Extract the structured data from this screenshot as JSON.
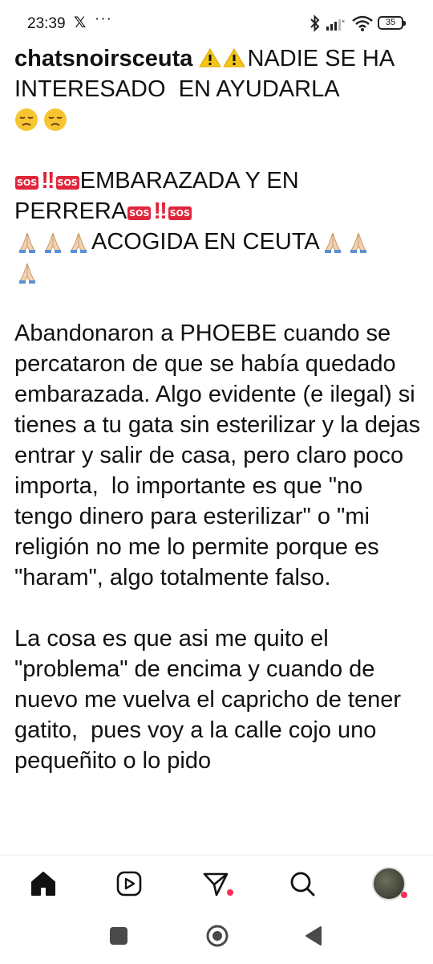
{
  "status_bar": {
    "time": "23:39",
    "x_logo": "𝕏",
    "more": "···",
    "battery": "35"
  },
  "caption": {
    "username": "chatsnoirsceuta",
    "line1_text": "NADIE SE HA INTERESADO  EN AYUDARLA",
    "sos_label": "SOS",
    "bang": "!!",
    "sos_line_a": "EMBARAZADA Y EN",
    "sos_line_b": "PERRERA",
    "acogida": "ACOGIDA EN CEUTA",
    "paragraph1": "Abandonaron a PHOEBE cuando se percataron de que se había quedado embarazada. Algo evidente (e ilegal) si tienes a tu gata sin esterilizar y la dejas entrar y salir de casa, pero claro poco importa,  lo importante es que \"no tengo dinero para esterilizar\" o \"mi religión no me lo permite porque es \"haram\", algo totalmente falso.",
    "paragraph2": "La cosa es que asi me quito el \"problema\" de encima y cuando de nuevo me vuelva el capricho de tener gatito,  pues voy a la calle cojo uno pequeñito o lo pido"
  },
  "icons": {
    "home": "home-icon",
    "reels": "reels-icon",
    "messages": "messages-icon",
    "search": "search-icon",
    "profile": "profile-avatar"
  },
  "colors": {
    "sos_red": "#e0263b",
    "notification": "#ff2d55",
    "warning_yellow": "#f5c518"
  }
}
